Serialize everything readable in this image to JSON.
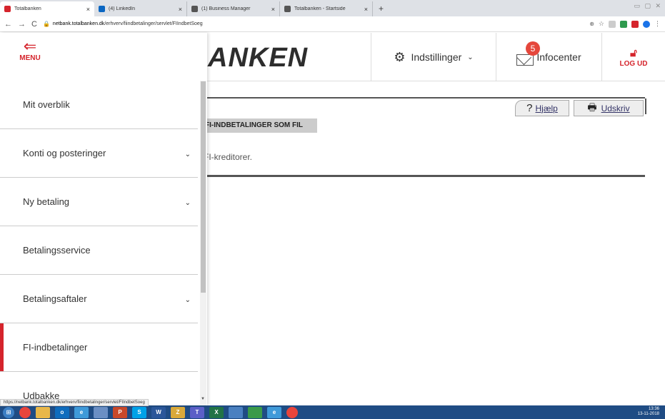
{
  "browser": {
    "tabs": [
      {
        "title": "Totalbanken",
        "color": "#d5242c"
      },
      {
        "title": "(4) LinkedIn",
        "color": "#0a66c2"
      },
      {
        "title": "(1) Business Manager",
        "color": "#555555"
      },
      {
        "title": "Totalbanken - Startside",
        "color": "#555555"
      }
    ],
    "new_tab": "+",
    "url_host": "netbank.totalbanken.dk",
    "url_path": "/erhverv/fiindbetalinger/servlet/FIIndbetSoeg",
    "status_url": "https://netbank.totalbanken.dk/erhverv/fiindbetalinger/servlet/FIIndbetSoeg"
  },
  "header": {
    "logo_text": "ANKEN",
    "settings_label": "Indstillinger",
    "infocenter_label": "Infocenter",
    "infocenter_badge": "5",
    "logout_label": "LOG UD",
    "accent": "#d5242c"
  },
  "sidebar": {
    "menu_label": "MENU",
    "items": [
      {
        "label": "Mit overblik"
      },
      {
        "label": "Konti og posteringer"
      },
      {
        "label": "Ny betaling"
      },
      {
        "label": "Betalingsservice"
      },
      {
        "label": "Betalingsaftaler"
      },
      {
        "label": "FI-indbetalinger"
      },
      {
        "label": "Udbakke"
      }
    ]
  },
  "content": {
    "help_label": "Hjælp",
    "print_label": "Udskriv",
    "section_label": "FI-INDBETALINGER SOM FIL",
    "description": "FI-kreditorer."
  },
  "taskbar": {
    "time": "13:36",
    "date": "13-11-2018"
  }
}
